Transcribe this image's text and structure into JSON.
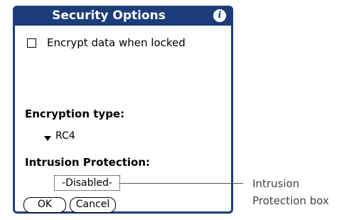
{
  "dialog": {
    "title": "Security Options",
    "info_icon": "info-icon",
    "checkbox_label": "Encrypt data when locked",
    "checkbox_checked": false,
    "encryption_type_label": "Encryption type:",
    "encryption_type_value": "RC4",
    "intrusion_label": "Intrusion Protection:",
    "intrusion_value": "-Disabled-",
    "ok_label": "OK",
    "cancel_label": "Cancel"
  },
  "callout": {
    "line1": "Intrusion",
    "line2": "Protection box"
  },
  "colors": {
    "titlebar": "#1c3d7a",
    "callout_text": "#444444"
  }
}
